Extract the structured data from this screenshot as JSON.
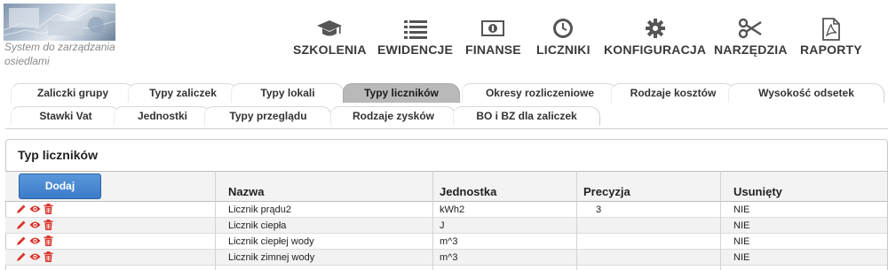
{
  "app": {
    "tagline": "System do zarządzania osiedlami"
  },
  "nav": {
    "items": [
      {
        "label": "SZKOLENIA",
        "icon": "graduation-cap-icon"
      },
      {
        "label": "EWIDENCJE",
        "icon": "list-icon"
      },
      {
        "label": "FINANSE",
        "icon": "money-icon"
      },
      {
        "label": "LICZNIKI",
        "icon": "clock-icon"
      },
      {
        "label": "KONFIGURACJA",
        "icon": "gear-icon"
      },
      {
        "label": "NARZĘDZIA",
        "icon": "scissors-icon"
      },
      {
        "label": "RAPORTY",
        "icon": "pdf-file-icon"
      }
    ]
  },
  "tabs": {
    "row1": [
      {
        "label": "Zaliczki grupy"
      },
      {
        "label": "Typy zaliczek"
      },
      {
        "label": "Typy lokali"
      },
      {
        "label": "Typy liczników",
        "active": true
      },
      {
        "label": "Okresy rozliczeniowe"
      },
      {
        "label": "Rodzaje kosztów"
      },
      {
        "label": "Wysokość odsetek"
      }
    ],
    "row2": [
      {
        "label": "Stawki Vat"
      },
      {
        "label": "Jednostki"
      },
      {
        "label": "Typy przeglądu"
      },
      {
        "label": "Rodzaje zysków"
      },
      {
        "label": "BO i BZ dla zaliczek"
      }
    ]
  },
  "panel": {
    "title": "Typ liczników",
    "add_button": "Dodaj"
  },
  "table": {
    "columns": [
      "Nazwa",
      "Jednostka",
      "Precyzja",
      "Usunięty"
    ],
    "rows": [
      {
        "nazwa": "Licznik prądu2",
        "jednostka": "kWh2",
        "precyzja": "3",
        "usuniety": "NIE"
      },
      {
        "nazwa": "Licznik ciepła",
        "jednostka": "J",
        "precyzja": "",
        "usuniety": "NIE"
      },
      {
        "nazwa": "Licznik ciepłej wody",
        "jednostka": "m^3",
        "precyzja": "",
        "usuniety": "NIE"
      },
      {
        "nazwa": "Licznik zimnej wody",
        "jednostka": "m^3",
        "precyzja": "",
        "usuniety": "NIE"
      }
    ],
    "row_action_icons": [
      "pencil-icon",
      "eye-icon",
      "trash-icon"
    ]
  },
  "colors": {
    "accent_button": "#3b7cc8",
    "active_tab": "#b9b9b9",
    "action_icon": "#d9342b"
  }
}
